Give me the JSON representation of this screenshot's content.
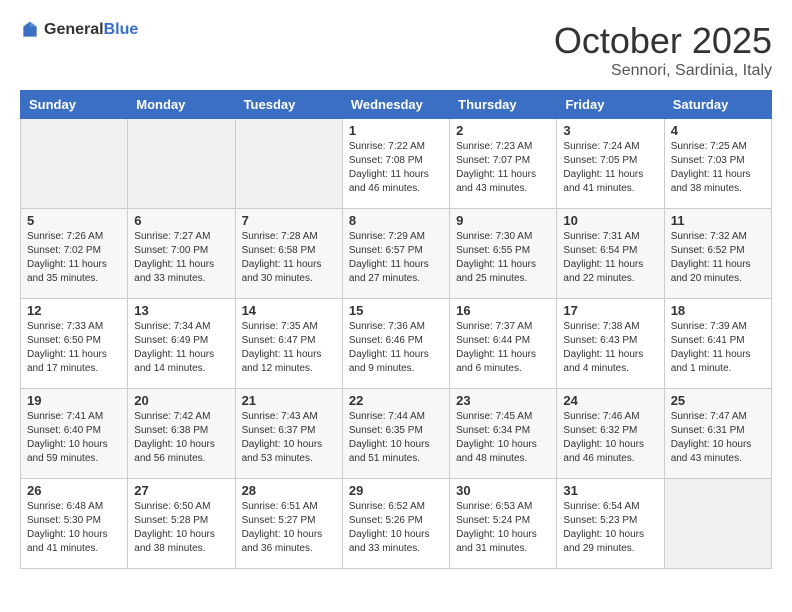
{
  "header": {
    "logo_general": "General",
    "logo_blue": "Blue",
    "month": "October 2025",
    "location": "Sennori, Sardinia, Italy"
  },
  "days_of_week": [
    "Sunday",
    "Monday",
    "Tuesday",
    "Wednesday",
    "Thursday",
    "Friday",
    "Saturday"
  ],
  "weeks": [
    [
      {
        "day": "",
        "info": ""
      },
      {
        "day": "",
        "info": ""
      },
      {
        "day": "",
        "info": ""
      },
      {
        "day": "1",
        "info": "Sunrise: 7:22 AM\nSunset: 7:08 PM\nDaylight: 11 hours\nand 46 minutes."
      },
      {
        "day": "2",
        "info": "Sunrise: 7:23 AM\nSunset: 7:07 PM\nDaylight: 11 hours\nand 43 minutes."
      },
      {
        "day": "3",
        "info": "Sunrise: 7:24 AM\nSunset: 7:05 PM\nDaylight: 11 hours\nand 41 minutes."
      },
      {
        "day": "4",
        "info": "Sunrise: 7:25 AM\nSunset: 7:03 PM\nDaylight: 11 hours\nand 38 minutes."
      }
    ],
    [
      {
        "day": "5",
        "info": "Sunrise: 7:26 AM\nSunset: 7:02 PM\nDaylight: 11 hours\nand 35 minutes."
      },
      {
        "day": "6",
        "info": "Sunrise: 7:27 AM\nSunset: 7:00 PM\nDaylight: 11 hours\nand 33 minutes."
      },
      {
        "day": "7",
        "info": "Sunrise: 7:28 AM\nSunset: 6:58 PM\nDaylight: 11 hours\nand 30 minutes."
      },
      {
        "day": "8",
        "info": "Sunrise: 7:29 AM\nSunset: 6:57 PM\nDaylight: 11 hours\nand 27 minutes."
      },
      {
        "day": "9",
        "info": "Sunrise: 7:30 AM\nSunset: 6:55 PM\nDaylight: 11 hours\nand 25 minutes."
      },
      {
        "day": "10",
        "info": "Sunrise: 7:31 AM\nSunset: 6:54 PM\nDaylight: 11 hours\nand 22 minutes."
      },
      {
        "day": "11",
        "info": "Sunrise: 7:32 AM\nSunset: 6:52 PM\nDaylight: 11 hours\nand 20 minutes."
      }
    ],
    [
      {
        "day": "12",
        "info": "Sunrise: 7:33 AM\nSunset: 6:50 PM\nDaylight: 11 hours\nand 17 minutes."
      },
      {
        "day": "13",
        "info": "Sunrise: 7:34 AM\nSunset: 6:49 PM\nDaylight: 11 hours\nand 14 minutes."
      },
      {
        "day": "14",
        "info": "Sunrise: 7:35 AM\nSunset: 6:47 PM\nDaylight: 11 hours\nand 12 minutes."
      },
      {
        "day": "15",
        "info": "Sunrise: 7:36 AM\nSunset: 6:46 PM\nDaylight: 11 hours\nand 9 minutes."
      },
      {
        "day": "16",
        "info": "Sunrise: 7:37 AM\nSunset: 6:44 PM\nDaylight: 11 hours\nand 6 minutes."
      },
      {
        "day": "17",
        "info": "Sunrise: 7:38 AM\nSunset: 6:43 PM\nDaylight: 11 hours\nand 4 minutes."
      },
      {
        "day": "18",
        "info": "Sunrise: 7:39 AM\nSunset: 6:41 PM\nDaylight: 11 hours\nand 1 minute."
      }
    ],
    [
      {
        "day": "19",
        "info": "Sunrise: 7:41 AM\nSunset: 6:40 PM\nDaylight: 10 hours\nand 59 minutes."
      },
      {
        "day": "20",
        "info": "Sunrise: 7:42 AM\nSunset: 6:38 PM\nDaylight: 10 hours\nand 56 minutes."
      },
      {
        "day": "21",
        "info": "Sunrise: 7:43 AM\nSunset: 6:37 PM\nDaylight: 10 hours\nand 53 minutes."
      },
      {
        "day": "22",
        "info": "Sunrise: 7:44 AM\nSunset: 6:35 PM\nDaylight: 10 hours\nand 51 minutes."
      },
      {
        "day": "23",
        "info": "Sunrise: 7:45 AM\nSunset: 6:34 PM\nDaylight: 10 hours\nand 48 minutes."
      },
      {
        "day": "24",
        "info": "Sunrise: 7:46 AM\nSunset: 6:32 PM\nDaylight: 10 hours\nand 46 minutes."
      },
      {
        "day": "25",
        "info": "Sunrise: 7:47 AM\nSunset: 6:31 PM\nDaylight: 10 hours\nand 43 minutes."
      }
    ],
    [
      {
        "day": "26",
        "info": "Sunrise: 6:48 AM\nSunset: 5:30 PM\nDaylight: 10 hours\nand 41 minutes."
      },
      {
        "day": "27",
        "info": "Sunrise: 6:50 AM\nSunset: 5:28 PM\nDaylight: 10 hours\nand 38 minutes."
      },
      {
        "day": "28",
        "info": "Sunrise: 6:51 AM\nSunset: 5:27 PM\nDaylight: 10 hours\nand 36 minutes."
      },
      {
        "day": "29",
        "info": "Sunrise: 6:52 AM\nSunset: 5:26 PM\nDaylight: 10 hours\nand 33 minutes."
      },
      {
        "day": "30",
        "info": "Sunrise: 6:53 AM\nSunset: 5:24 PM\nDaylight: 10 hours\nand 31 minutes."
      },
      {
        "day": "31",
        "info": "Sunrise: 6:54 AM\nSunset: 5:23 PM\nDaylight: 10 hours\nand 29 minutes."
      },
      {
        "day": "",
        "info": ""
      }
    ]
  ]
}
